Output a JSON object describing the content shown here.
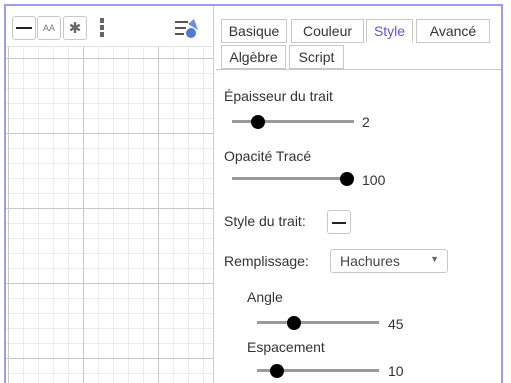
{
  "tabs": [
    {
      "label": "Basique",
      "active": false
    },
    {
      "label": "Couleur",
      "active": false
    },
    {
      "label": "Style",
      "active": true
    },
    {
      "label": "Avancé",
      "active": false
    },
    {
      "label": "Algèbre",
      "active": false
    },
    {
      "label": "Script",
      "active": false
    }
  ],
  "style_bar": {
    "text_button_label": "AA",
    "icons": [
      "line-style-icon",
      "text-size-icon",
      "gear-icon",
      "more-icon",
      "object-properties-icon"
    ]
  },
  "properties": {
    "line_thickness": {
      "label": "Épaisseur du trait",
      "value": "2",
      "fraction": 0.18
    },
    "line_opacity": {
      "label": "Opacité Tracé",
      "value": "100",
      "fraction": 1.0
    },
    "line_style": {
      "label": "Style du trait:"
    },
    "fill": {
      "label": "Remplissage:",
      "selected": "Hachures"
    },
    "angle": {
      "label": "Angle",
      "value": "45",
      "fraction": 0.28
    },
    "spacing": {
      "label": "Espacement",
      "value": "10",
      "fraction": 0.12
    }
  },
  "colors": {
    "accent": "#6557d2",
    "frame": "#9a9ef2"
  }
}
